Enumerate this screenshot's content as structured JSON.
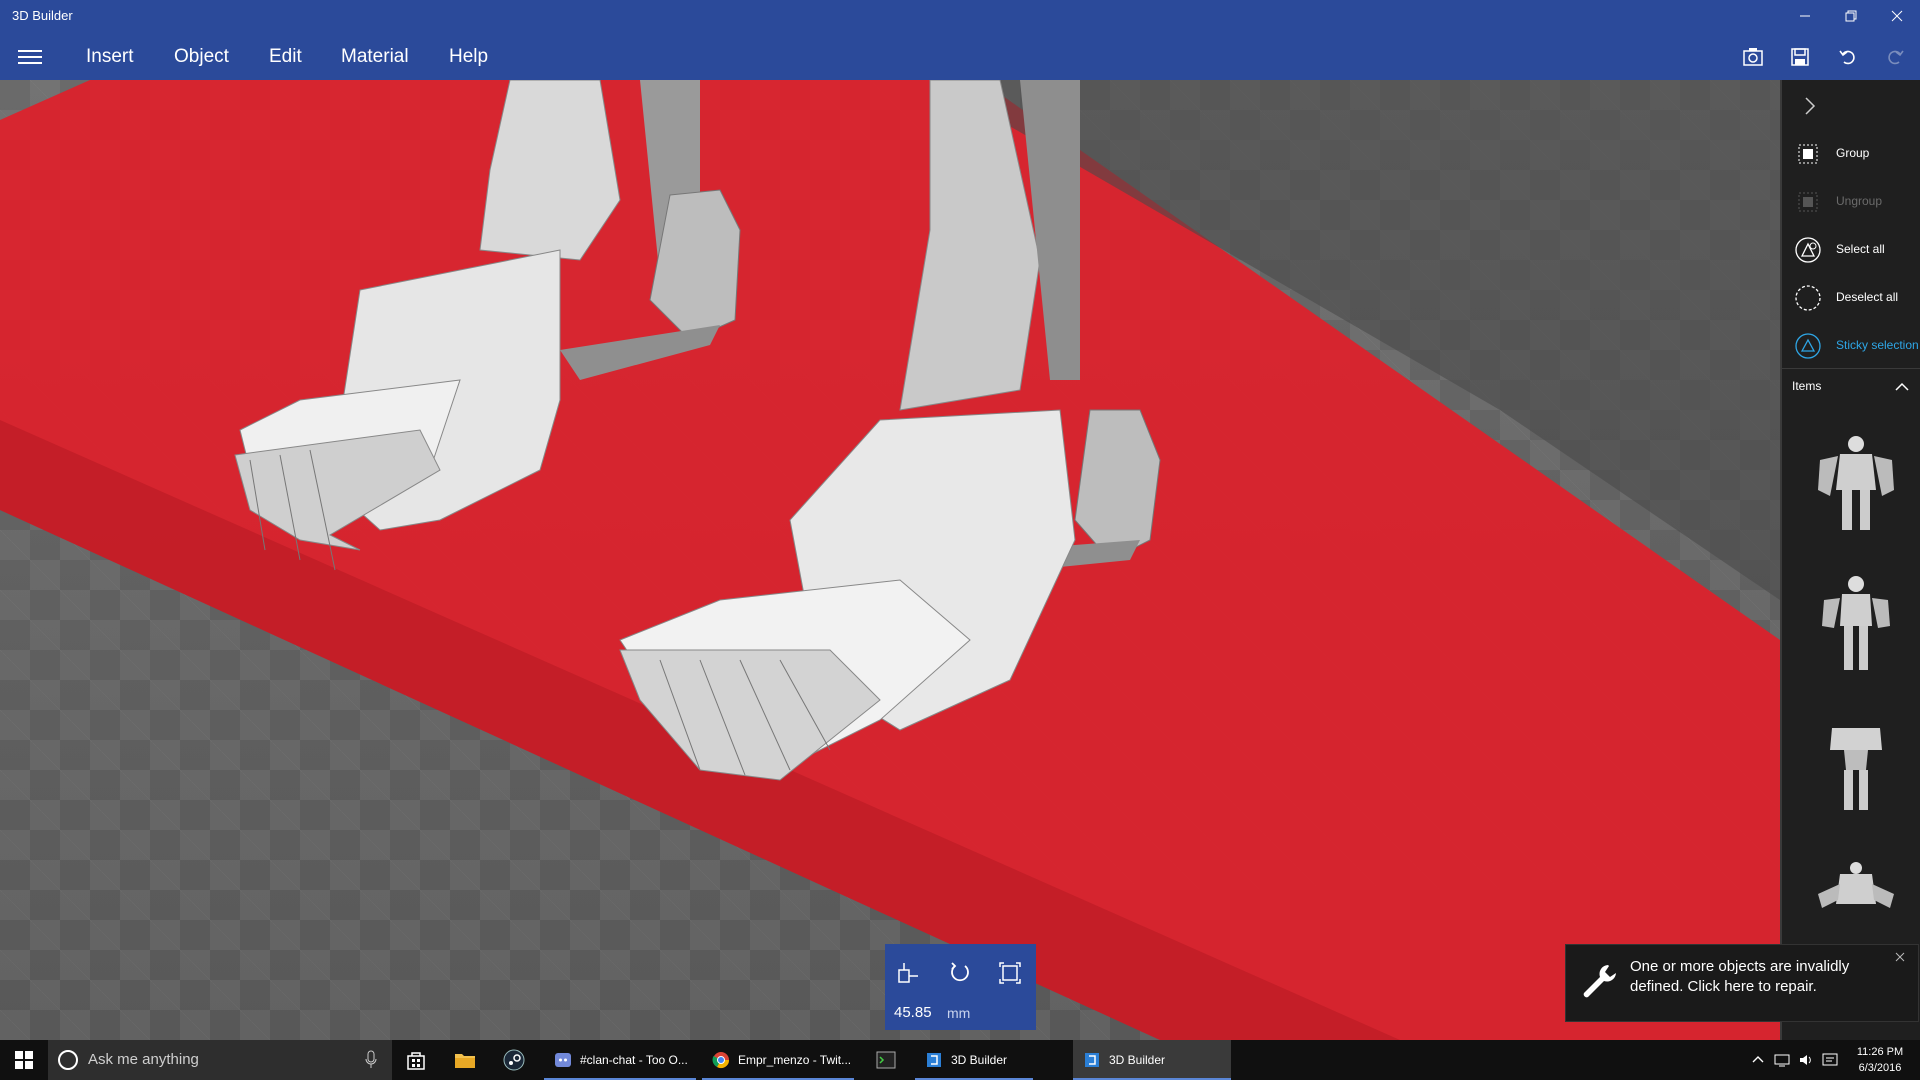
{
  "titlebar": {
    "title": "3D Builder"
  },
  "menu": {
    "items": [
      "Insert",
      "Object",
      "Edit",
      "Material",
      "Help"
    ]
  },
  "transform": {
    "value": "45.85",
    "unit": "mm"
  },
  "rightpanel": {
    "actions": [
      {
        "label": "Group",
        "state": "enabled"
      },
      {
        "label": "Ungroup",
        "state": "disabled"
      },
      {
        "label": "Select all",
        "state": "enabled"
      },
      {
        "label": "Deselect all",
        "state": "enabled"
      },
      {
        "label": "Sticky selection",
        "state": "active"
      }
    ],
    "items_label": "Items"
  },
  "notification": {
    "message": "One or more objects are invalidly defined. Click here to repair."
  },
  "taskbar": {
    "search_placeholder": "Ask me anything",
    "apps": [
      {
        "label": "#clan-chat - Too O...",
        "icon": "discord-icon"
      },
      {
        "label": "Empr_menzo - Twit...",
        "icon": "chrome-icon"
      },
      {
        "label": "3D Builder",
        "icon": "3d-builder-icon"
      },
      {
        "label": "3D Builder",
        "icon": "3d-builder-icon"
      }
    ],
    "time": "11:26 PM",
    "date": "6/3/2016"
  },
  "colors": {
    "accent": "#2b4a9a",
    "selection_red": "#e0202a",
    "active_blue": "#2ea6e6"
  }
}
